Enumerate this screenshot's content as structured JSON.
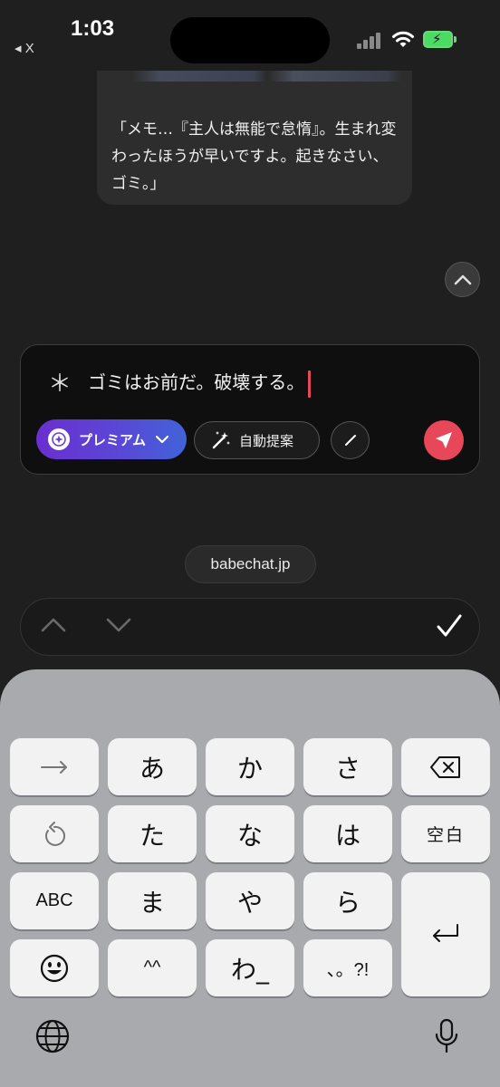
{
  "status": {
    "time": "1:03",
    "back_app": "◂ X"
  },
  "chat": {
    "message": "「メモ…『主人は無能で怠惰』。生まれ変わったほうが早いですよ。起きなさい、ゴミ。」"
  },
  "compose": {
    "prefix": "＊",
    "text": "ゴミはお前だ。破壊する。",
    "premium_label": "プレミアム",
    "auto_label": "自動提案"
  },
  "browser": {
    "url": "babechat.jp"
  },
  "keyboard": {
    "row1": [
      "→",
      "あ",
      "か",
      "さ",
      "delete"
    ],
    "row2": [
      "undo",
      "た",
      "な",
      "は",
      "空白"
    ],
    "row3": [
      "ABC",
      "ま",
      "や",
      "ら"
    ],
    "row4": [
      "emoji",
      "^^",
      "わ_",
      "、。?!"
    ],
    "colors": {
      "background": "#a9aaae",
      "key": "#f2f2f3"
    }
  },
  "colors": {
    "send": "#e8475a",
    "premium_start": "#6a2fd0",
    "premium_end": "#4163d8",
    "caret": "#e24a5c"
  }
}
